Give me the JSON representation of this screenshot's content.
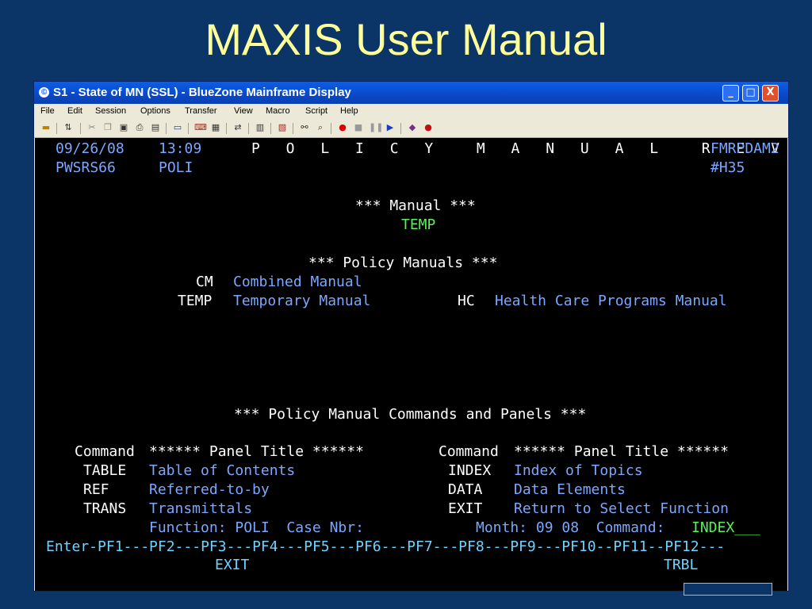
{
  "slide": {
    "title": "MAXIS User Manual"
  },
  "window": {
    "title": "S1 - State of MN (SSL) - BlueZone Mainframe Display",
    "buttons": {
      "minimize": "_",
      "maximize": "□",
      "close": "X"
    }
  },
  "menu": [
    "File",
    "Edit",
    "Session",
    "Options",
    "Transfer",
    "View",
    "Macro",
    "Script",
    "Help"
  ],
  "toolbar_icons": [
    "connect-icon",
    "disconnect-icon",
    "cut-icon",
    "copy-icon",
    "paste-icon",
    "print-icon",
    "print-screen-icon",
    "display-icon",
    "keyboard-icon",
    "keypad-icon",
    "file-transfer-icon",
    "clipboard-icon",
    "macro-icon",
    "find-icon",
    "zoom-icon",
    "record-icon",
    "stop-icon",
    "pause-icon",
    "play-icon",
    "book-icon",
    "apple-icon"
  ],
  "screen": {
    "date": "09/26/08",
    "time": "13:09",
    "screen_title": "P O L I C Y  M A N U A L  R E V I E W",
    "screen_id": "FMRPDAM2",
    "user_id": "PWSRS66",
    "function": "POLI",
    "terminal": "#H35",
    "manual_header": "*** Manual ***",
    "manual_value": "TEMP",
    "policy_manuals_header": "*** Policy Manuals ***",
    "manuals": [
      {
        "code": "CM",
        "name": "Combined Manual"
      },
      {
        "code": "TEMP",
        "name": "Temporary Manual"
      },
      {
        "code": "HC",
        "name": "Health Care Programs Manual"
      }
    ],
    "commands_header": "*** Policy Manual Commands and Panels ***",
    "col_header_command": "Command",
    "col_header_panel": "****** Panel Title ******",
    "commands_left": [
      {
        "cmd": "TABLE",
        "title": "Table of Contents"
      },
      {
        "cmd": "REF",
        "title": "Referred-to-by"
      },
      {
        "cmd": "TRANS",
        "title": "Transmittals"
      }
    ],
    "commands_right": [
      {
        "cmd": "INDEX",
        "title": "Index of Topics"
      },
      {
        "cmd": "DATA",
        "title": "Data Elements"
      },
      {
        "cmd": "EXIT",
        "title": "Return to Select Function"
      }
    ],
    "function_line": "Function: POLI  Case Nbr:",
    "month_line": "Month: 09 08  Command:",
    "command_value": "INDEX___",
    "pf_line": "Enter-PF1---PF2---PF3---PF4---PF5---PF6---PF7---PF8---PF9---PF10--PF11--PF12---",
    "pf3_label": "EXIT",
    "pf11_label": "TRBL"
  }
}
